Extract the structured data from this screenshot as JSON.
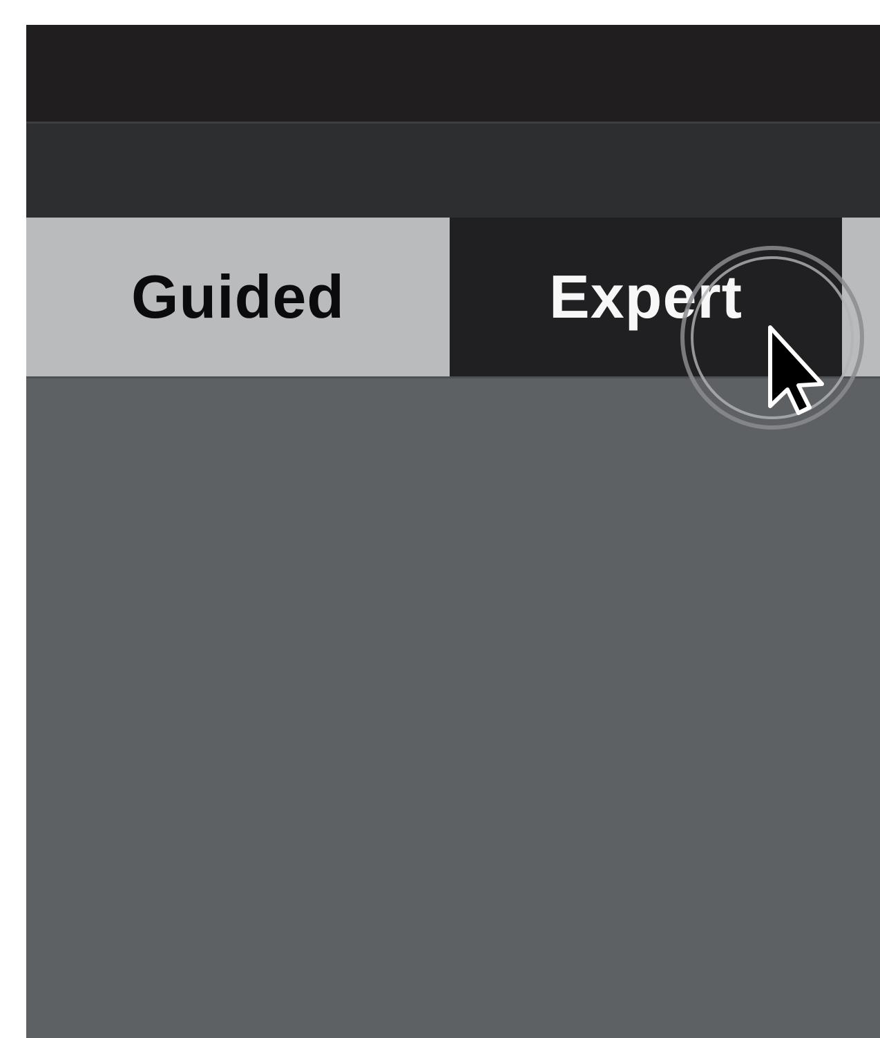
{
  "tabs": [
    {
      "label": "Guided",
      "active": false
    },
    {
      "label": "Expert",
      "active": true
    }
  ],
  "cursor": {
    "icon": "mouse-pointer-icon",
    "click_indicator": "click-ring-icon"
  },
  "colors": {
    "title_bar": "#201e1f",
    "toolbar": "#2d2e30",
    "tab_inactive": "#b9bbbc",
    "tab_active": "#201f21",
    "content": "#5e6164"
  }
}
